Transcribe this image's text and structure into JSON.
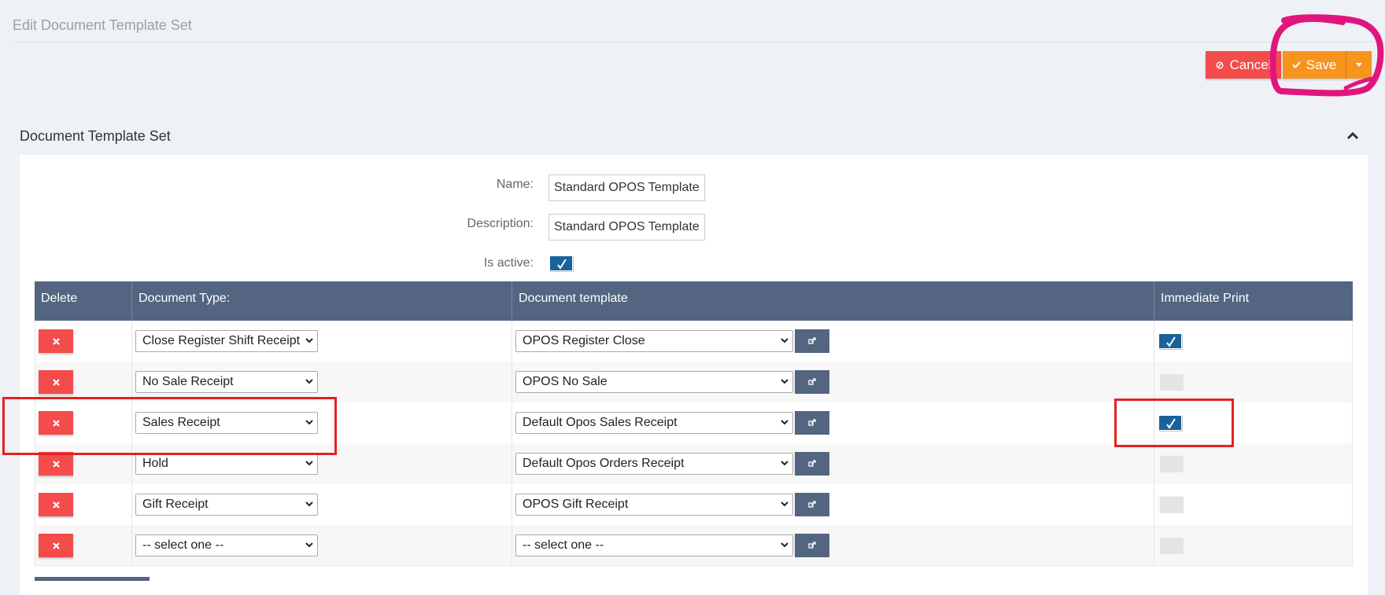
{
  "page": {
    "title": "Edit Document Template Set"
  },
  "toolbar": {
    "cancel_label": "Cancel",
    "save_label": "Save"
  },
  "section": {
    "title": "Document Template Set"
  },
  "form": {
    "name_label": "Name:",
    "name_value": "Standard OPOS Template",
    "description_label": "Description:",
    "description_value": "Standard OPOS Template",
    "is_active_label": "Is active:",
    "is_active": true
  },
  "table": {
    "headers": [
      "Delete",
      "Document Type:",
      "Document template",
      "Immediate Print"
    ],
    "rows": [
      {
        "document_type": "Close Register Shift Receipt",
        "document_template": "OPOS Register Close",
        "immediate_print": true
      },
      {
        "document_type": "No Sale Receipt",
        "document_template": "OPOS No Sale",
        "immediate_print": false
      },
      {
        "document_type": "Sales Receipt",
        "document_template": "Default Opos Sales Receipt",
        "immediate_print": true
      },
      {
        "document_type": "Hold",
        "document_template": "Default Opos Orders Receipt",
        "immediate_print": false
      },
      {
        "document_type": "Gift Receipt",
        "document_template": "OPOS Gift Receipt",
        "immediate_print": false
      },
      {
        "document_type": "-- select one --",
        "document_template": "-- select one --",
        "immediate_print": false
      }
    ]
  },
  "colors": {
    "cancel": "#f44b4b",
    "save": "#f7941e",
    "header": "#536580",
    "checkbox": "#19629a",
    "annotation_pink": "#e0167e",
    "annotation_red": "#e32222"
  }
}
